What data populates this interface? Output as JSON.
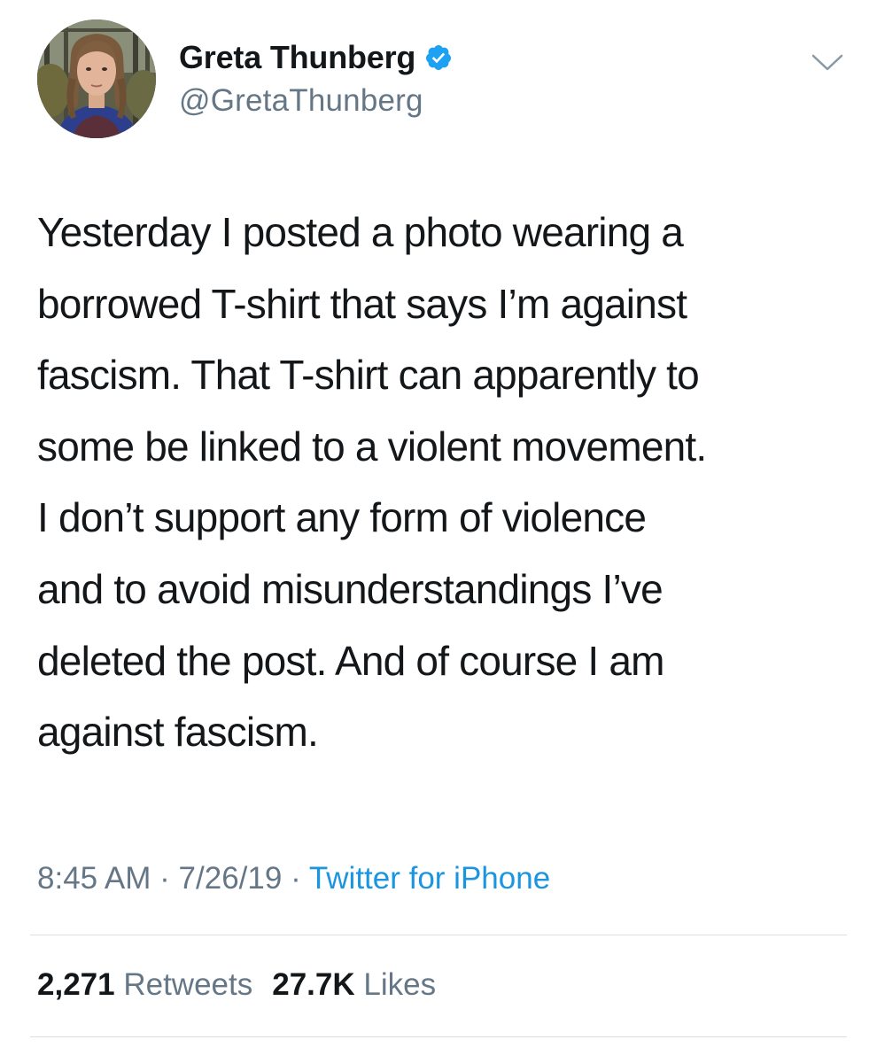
{
  "tweet": {
    "author": {
      "display_name": "Greta Thunberg",
      "handle": "@GretaThunberg",
      "verified": true
    },
    "text_lines": [
      "Yesterday I posted a photo wearing a",
      "borrowed T-shirt that says I’m against",
      "fascism. That T-shirt can apparently to",
      "some be linked to a violent movement.",
      "I don’t support any form of violence",
      "and to avoid misunderstandings I’ve",
      "deleted the post. And of course I am",
      "against fascism."
    ],
    "time": "8:45 AM",
    "date": "7/26/19",
    "separator": "·",
    "source": "Twitter for iPhone",
    "stats": {
      "retweets_count": "2,271",
      "retweets_label": "Retweets",
      "likes_count": "27.7K",
      "likes_label": "Likes"
    }
  },
  "icons": {
    "verified": "verified-badge-icon",
    "caret": "chevron-down-icon"
  },
  "colors": {
    "text": "#14171a",
    "secondary": "#657786",
    "link": "#1b95e0",
    "verified": "#1da1f2",
    "divider": "#dcdfe2"
  }
}
